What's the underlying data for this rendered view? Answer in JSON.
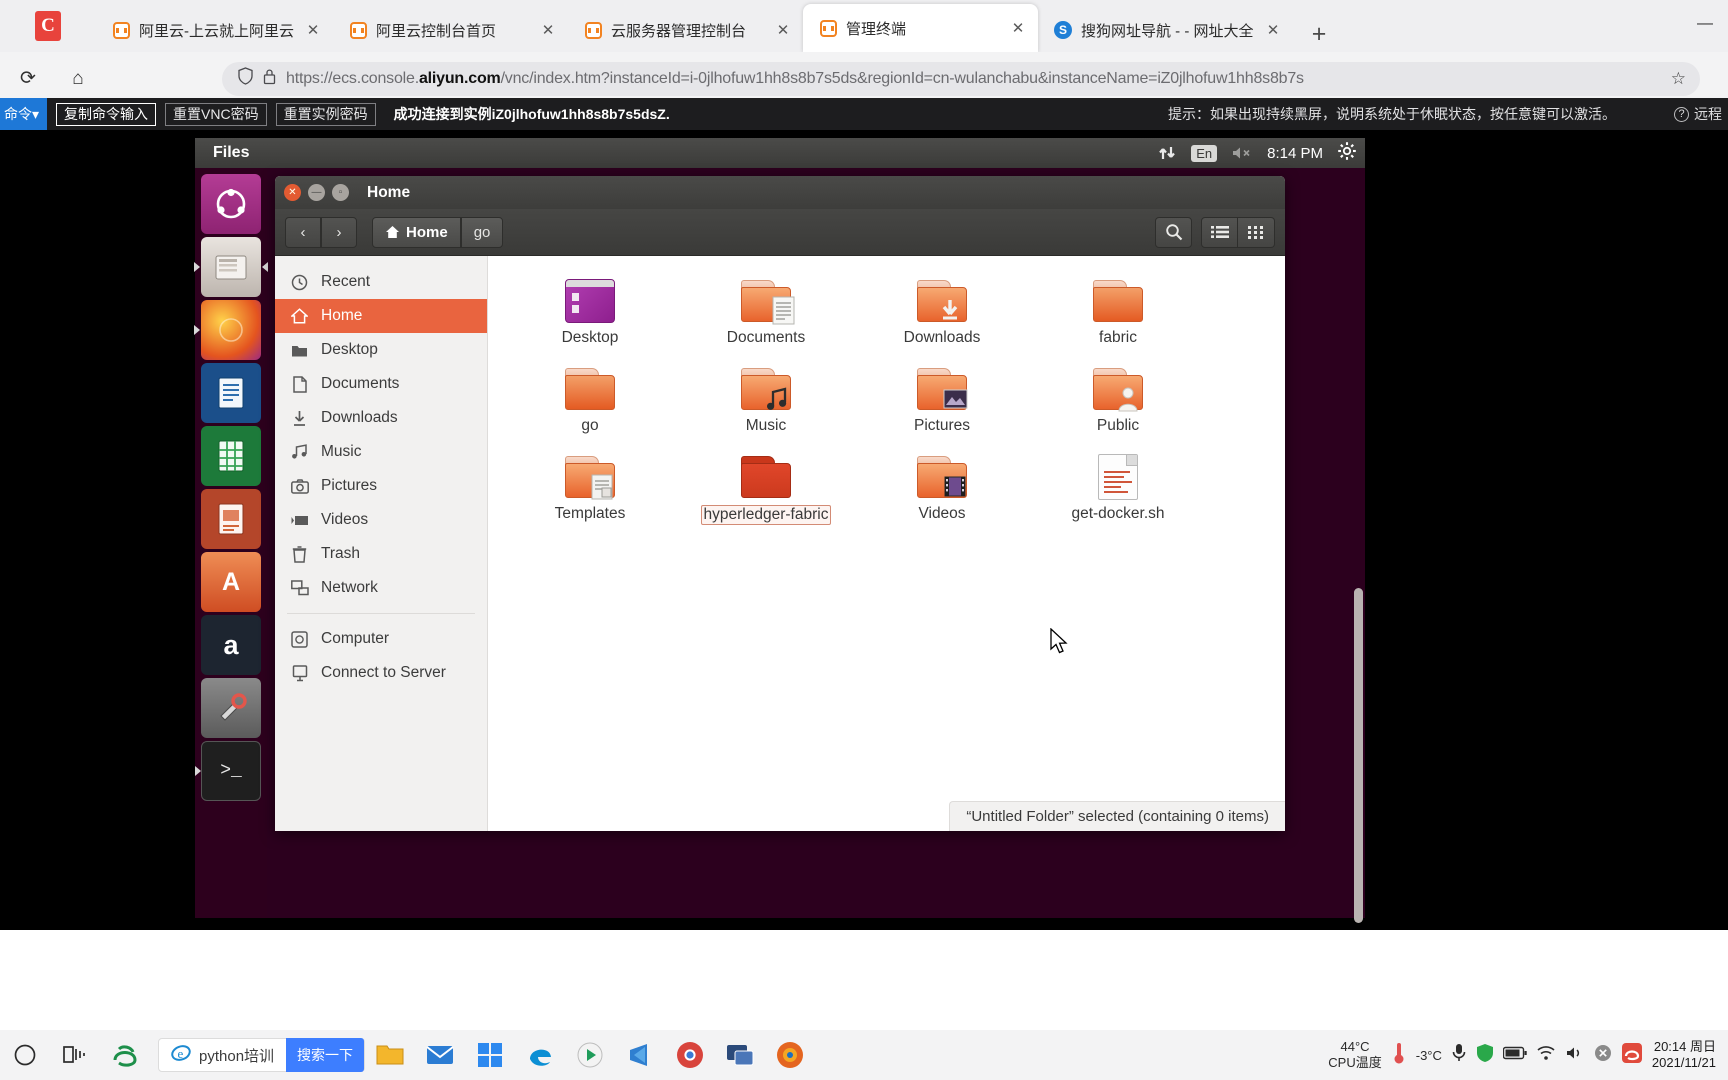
{
  "browser": {
    "brand_letter": "C",
    "tabs": [
      {
        "title": "阿里云-上云就上阿里云",
        "favicon": "aliyun-icon",
        "active": false
      },
      {
        "title": "阿里云控制台首页",
        "favicon": "aliyun-icon",
        "active": false
      },
      {
        "title": "云服务器管理控制台",
        "favicon": "aliyun-icon",
        "active": false
      },
      {
        "title": "管理终端",
        "favicon": "aliyun-icon",
        "active": true
      },
      {
        "title": "搜狗网址导航 -  - 网址大全,实用",
        "favicon": "sogou-icon",
        "active": false
      }
    ],
    "newtab_label": "+",
    "close_label": "✕",
    "minimize_label": "—",
    "url_prefix": "https://ecs.console.",
    "url_domain": "aliyun.com",
    "url_rest": "/vnc/index.htm?instanceId=i-0jlhofuw1hh8s8b7s5ds&regionId=cn-wulanchabu&instanceName=iZ0jlhofuw1hh8s8b7s",
    "reload_icon": "⟳",
    "home_icon": "⌂",
    "shield_icon": "shield",
    "lock_icon": "lock",
    "star_icon": "☆"
  },
  "vnc": {
    "send_key_label": "命令",
    "send_key_caret": "▾",
    "buttons": [
      {
        "label": "复制命令输入",
        "highlighted": true
      },
      {
        "label": "重置VNC密码",
        "highlighted": false
      },
      {
        "label": "重置实例密码",
        "highlighted": false
      }
    ],
    "status": "成功连接到实例iZ0jlhofuw1hh8s8b7s5dsZ.",
    "hint": "提示：如果出现持续黑屏，说明系统处于休眠状态，按任意键可以激活。",
    "help_label": "远程",
    "help_mark": "?"
  },
  "ubuntu": {
    "app_menu_title": "Files",
    "clock": "8:14 PM",
    "keyboard_layout": "En",
    "network_icon": "network-updown-icon",
    "volume_icon": "volume-muted-icon",
    "gear_icon": "system-settings-icon",
    "launcher": [
      {
        "name": "ubuntu-dash-icon",
        "glyph": "◉",
        "color": "#b03a8f"
      },
      {
        "name": "files-icon",
        "glyph": "🗀",
        "color": "#d8cfc7"
      },
      {
        "name": "firefox-icon",
        "glyph": "◕",
        "color": "#e46421"
      },
      {
        "name": "libreoffice-writer-icon",
        "glyph": "▤",
        "color": "#2a6099"
      },
      {
        "name": "libreoffice-calc-icon",
        "glyph": "▦",
        "color": "#30a34a"
      },
      {
        "name": "libreoffice-impress-icon",
        "glyph": "▥",
        "color": "#d1663a"
      },
      {
        "name": "ubuntu-software-icon",
        "glyph": "A",
        "color": "#e0683c"
      },
      {
        "name": "amazon-icon",
        "glyph": "a",
        "color": "#232f3e"
      },
      {
        "name": "system-settings-icon",
        "glyph": "✂",
        "color": "#6b6b6b"
      },
      {
        "name": "terminal-icon",
        "glyph": ">_",
        "color": "#2b2b2b"
      }
    ]
  },
  "nautilus": {
    "window_title": "Home",
    "back_icon": "‹",
    "forward_icon": "›",
    "breadcrumbs": [
      {
        "label": "Home",
        "icon": "home-icon"
      },
      {
        "label": "go",
        "icon": ""
      }
    ],
    "search_icon": "search-icon",
    "list_view_icon": "list-view-icon",
    "grid_view_icon": "grid-view-icon",
    "places": [
      {
        "label": "Recent",
        "icon": "clock-icon",
        "selected": false
      },
      {
        "label": "Home",
        "icon": "home-icon",
        "selected": true
      },
      {
        "label": "Desktop",
        "icon": "folder-icon",
        "selected": false
      },
      {
        "label": "Documents",
        "icon": "document-icon",
        "selected": false
      },
      {
        "label": "Downloads",
        "icon": "download-icon",
        "selected": false
      },
      {
        "label": "Music",
        "icon": "music-icon",
        "selected": false
      },
      {
        "label": "Pictures",
        "icon": "camera-icon",
        "selected": false
      },
      {
        "label": "Videos",
        "icon": "video-icon",
        "selected": false
      },
      {
        "label": "Trash",
        "icon": "trash-icon",
        "selected": false
      },
      {
        "label": "Network",
        "icon": "network-icon",
        "selected": false
      }
    ],
    "places_bottom": [
      {
        "label": "Computer",
        "icon": "computer-icon",
        "selected": false
      },
      {
        "label": "Connect to Server",
        "icon": "server-icon",
        "selected": false
      }
    ],
    "files": [
      {
        "label": "Desktop",
        "kind": "terminal-folder",
        "selected": false
      },
      {
        "label": "Documents",
        "kind": "folder-documents",
        "selected": false
      },
      {
        "label": "Downloads",
        "kind": "folder-downloads",
        "selected": false
      },
      {
        "label": "fabric",
        "kind": "folder",
        "selected": false
      },
      {
        "label": "go",
        "kind": "folder",
        "selected": false
      },
      {
        "label": "Music",
        "kind": "folder-music",
        "selected": false
      },
      {
        "label": "Pictures",
        "kind": "folder-pictures",
        "selected": false
      },
      {
        "label": "Public",
        "kind": "folder-public",
        "selected": false
      },
      {
        "label": "Templates",
        "kind": "folder-templates",
        "selected": false
      },
      {
        "label": "hyperledger-fabric",
        "kind": "folder-red",
        "selected": true
      },
      {
        "label": "Videos",
        "kind": "folder-videos",
        "selected": false
      },
      {
        "label": "get-docker.sh",
        "kind": "script",
        "selected": false
      }
    ],
    "status_text": "“Untitled Folder” selected  (containing 0 items)"
  },
  "taskbar": {
    "start_icon": "windows-start-icon",
    "taskview_icon": "task-view-icon",
    "search": {
      "engine_icon": "ie-icon",
      "value": "python培训",
      "button_label": "搜索一下"
    },
    "apps": [
      {
        "name": "explorer-icon",
        "glyph": "🗀",
        "color": "#f5b429"
      },
      {
        "name": "mail-icon",
        "glyph": "✉",
        "color": "#2b7cd3"
      },
      {
        "name": "store-icon",
        "glyph": "▦",
        "color": "#2d89ef"
      },
      {
        "name": "edge-icon",
        "glyph": "e",
        "color": "#0c8fd4"
      },
      {
        "name": "media-player-icon",
        "glyph": "▶",
        "color": "#1f9c5a"
      },
      {
        "name": "vscode-icon",
        "glyph": "✕",
        "color": "#2f7fd0"
      },
      {
        "name": "chrome-icon",
        "glyph": "◉",
        "color": "#d8443c"
      },
      {
        "name": "remote-desktop-icon",
        "glyph": "▭",
        "color": "#2b4a7a"
      },
      {
        "name": "firefox-icon",
        "glyph": "◕",
        "color": "#e4651f"
      }
    ],
    "cpu_temp_value": "44°C",
    "cpu_temp_label": "CPU温度",
    "weather_temp": "-3°C",
    "weather_icon": "thermometer-icon",
    "tray_icons": [
      "mic-icon",
      "shield-icon",
      "battery-icon",
      "wifi-icon",
      "speaker-icon",
      "close-icon",
      "sogou-ime-icon"
    ],
    "clock_time": "20:14 周日",
    "clock_date": "2021/11/21"
  }
}
